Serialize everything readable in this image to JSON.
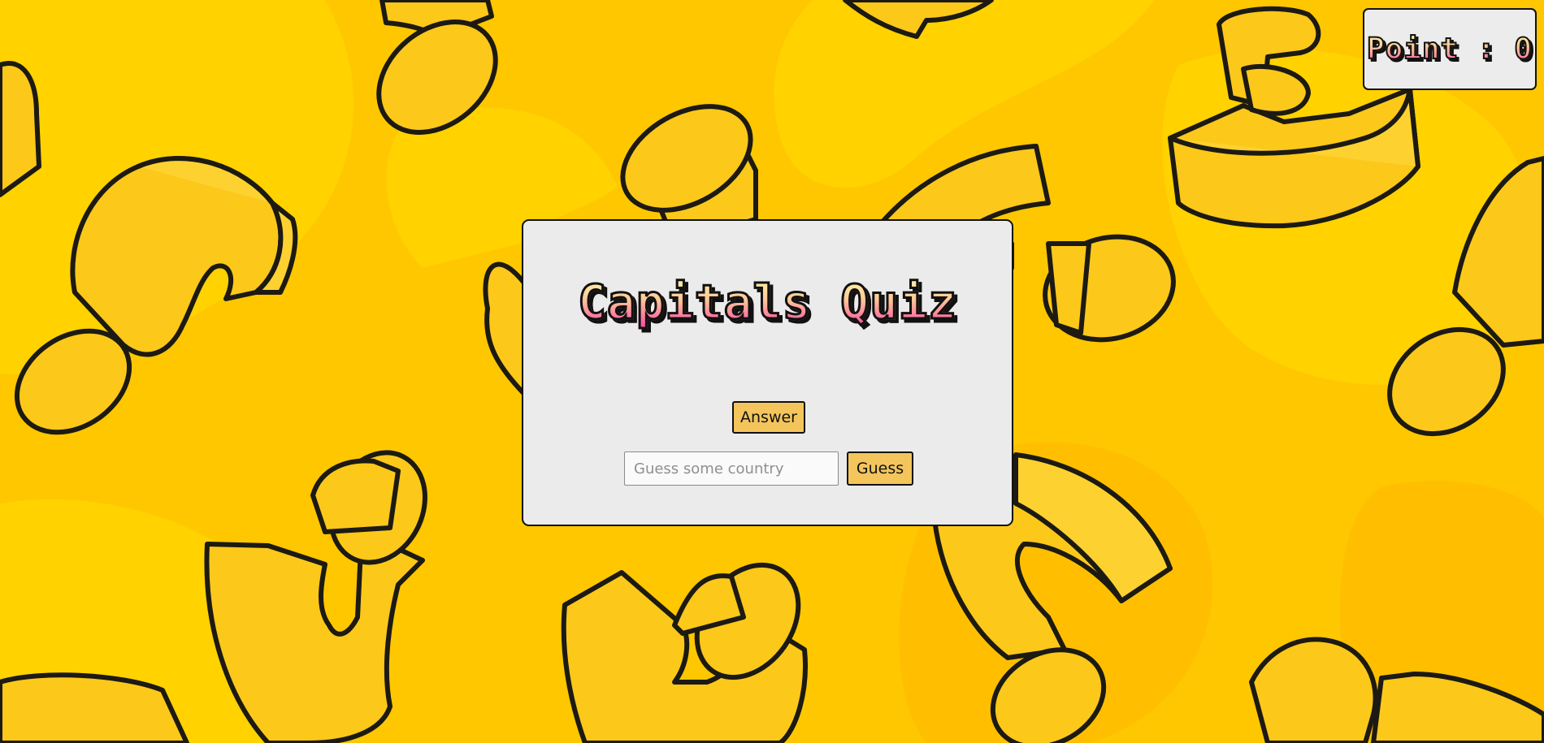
{
  "score": {
    "label": "Point : 0"
  },
  "quiz": {
    "title": "Capitals Quiz",
    "answer_label": "Answer",
    "guess_placeholder": "Guess some country",
    "guess_value": "",
    "guess_label": "Guess"
  },
  "background": {
    "pattern_icon": "question-mark-pattern",
    "base_color": "#ffc700",
    "shape_color": "#fcc81a",
    "outline_color": "#1c1a12"
  },
  "colors": {
    "panel": "#ebebeb",
    "button": "#f3c55c",
    "title_gradient": [
      "#fffca6",
      "#ffc896",
      "#ff3fa4"
    ]
  }
}
